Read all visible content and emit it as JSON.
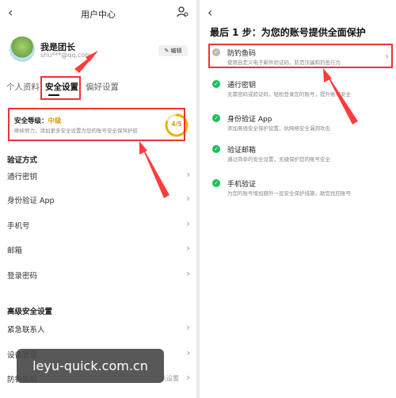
{
  "left": {
    "header": {
      "title": "用户中心"
    },
    "profile": {
      "name": "我是团长",
      "email": "shu***@qq.com",
      "edit_label": "编辑"
    },
    "tabs": [
      {
        "label": "个人资料"
      },
      {
        "label": "安全设置"
      },
      {
        "label": "偏好设置"
      }
    ],
    "security_card": {
      "label": "安全等级：",
      "level": "中级",
      "description": "继续努力，添加更多安全设置为您的账号安全保驾护航",
      "score": "4/5",
      "score_fraction": 0.8
    },
    "verification": {
      "title": "验证方式",
      "items": [
        {
          "label": "通行密钥"
        },
        {
          "label": "身份验证 App"
        },
        {
          "label": "手机号"
        },
        {
          "label": "邮箱"
        },
        {
          "label": "登录密码"
        }
      ]
    },
    "advanced": {
      "title": "高级安全设置",
      "items": [
        {
          "label": "紧急联系人"
        },
        {
          "label": "设备管理"
        },
        {
          "label": "防钓鱼码",
          "trailing": "未设置"
        }
      ]
    }
  },
  "watermark": "leyu-quick.com.cn",
  "right": {
    "heading": "最后 1 步：为您的账号提供全面保护",
    "steps": [
      {
        "name": "防钓鱼码",
        "desc": "使用自定义电子邮件验证码，防范诈骗和钓鱼行为",
        "done": false
      },
      {
        "name": "通行密钥",
        "desc": "无需密码或验证码，轻松登录您的账号，提升账号安全",
        "done": true
      },
      {
        "name": "身份验证 App",
        "desc": "添加离线安全保护设置，抗网络安全漏洞攻击",
        "done": true
      },
      {
        "name": "验证邮箱",
        "desc": "通过简单的安全设置，无缝保护您的账号安全",
        "done": true
      },
      {
        "name": "手机验证",
        "desc": "为您的账号增加额外一层安全保护措施，助您找回账号",
        "done": true
      }
    ]
  },
  "colors": {
    "highlight_red": "#e33333",
    "check_green": "#1fbf5a",
    "pending_gray": "#b8b8b8",
    "level_gold": "#d6a000"
  }
}
